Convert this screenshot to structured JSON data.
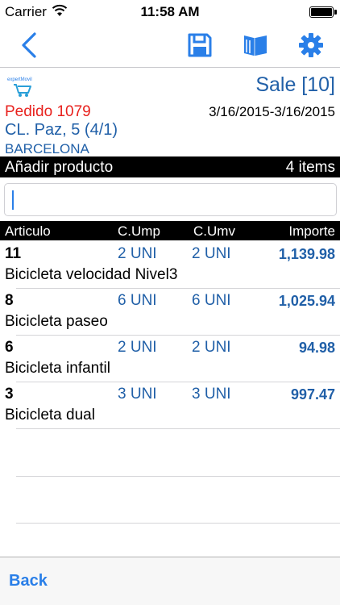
{
  "status_bar": {
    "carrier": "Carrier",
    "time": "11:58 AM"
  },
  "nav_bar": {
    "icons": [
      "back-chevron-icon",
      "save-icon",
      "book-icon",
      "gear-icon"
    ],
    "accent_color": "#2a7fe8"
  },
  "header": {
    "sale_label": "Sale [10]",
    "pedido": "Pedido 1079",
    "dates": "3/16/2015-3/16/2015",
    "address": "CL. Paz, 5 (4/1)",
    "city": "BARCELONA",
    "logo_text": "expertMovil"
  },
  "add_bar": {
    "label": "Añadir producto",
    "count": "4 items"
  },
  "search": {
    "value": "",
    "placeholder": ""
  },
  "table": {
    "headers": {
      "articulo": "Articulo",
      "cump": "C.Ump",
      "cumv": "C.Umv",
      "importe": "Importe"
    },
    "rows": [
      {
        "qty": "11",
        "ump": "2 UNI",
        "umv": "2 UNI",
        "importe": "1,139.98",
        "desc": "Bicicleta velocidad Nivel3"
      },
      {
        "qty": "8",
        "ump": "6 UNI",
        "umv": "6 UNI",
        "importe": "1,025.94",
        "desc": "Bicicleta paseo"
      },
      {
        "qty": "6",
        "ump": "2 UNI",
        "umv": "2 UNI",
        "importe": "94.98",
        "desc": "Bicicleta infantil"
      },
      {
        "qty": "3",
        "ump": "3 UNI",
        "umv": "3 UNI",
        "importe": "997.47",
        "desc": "Bicicleta dual"
      }
    ]
  },
  "bottom_bar": {
    "back_label": "Back"
  },
  "colors": {
    "accent": "#2a7fe8",
    "value_blue": "#2160a8",
    "pedido_red": "#e8211d"
  }
}
